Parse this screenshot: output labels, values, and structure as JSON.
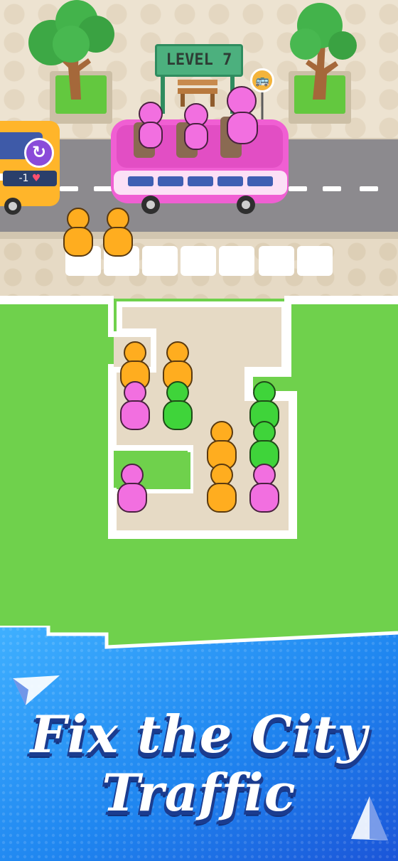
{
  "hud": {
    "level_label": "LEVEL 7",
    "lives_text": "-1",
    "restart_icon": "restart-icon",
    "bus_stop_icon": "bus-icon",
    "heart_icon": "heart-icon"
  },
  "banner": {
    "line1": "Fix the City",
    "line2": "Traffic"
  },
  "colors": {
    "pink": "#f26fe0",
    "orange": "#ffad1f",
    "green": "#3fd43a",
    "bus_body": "#f05fd3",
    "banner_blue": "#2a7ee8"
  }
}
